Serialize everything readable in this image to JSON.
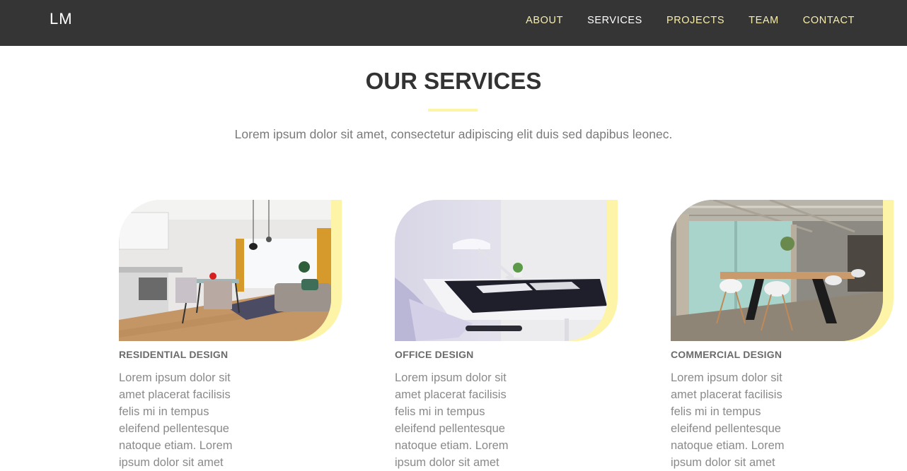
{
  "header": {
    "logo": "LM",
    "nav": [
      {
        "label": "ABOUT"
      },
      {
        "label": "SERVICES"
      },
      {
        "label": "PROJECTS"
      },
      {
        "label": "TEAM"
      },
      {
        "label": "CONTACT"
      }
    ],
    "active_item": "SERVICES"
  },
  "services": {
    "title": "OUR SERVICES",
    "subtitle": "Lorem ipsum dolor sit amet, consectetur adipiscing elit duis sed dapibus leonec.",
    "cards": [
      {
        "title": "RESIDENTIAL DESIGN",
        "text": "Lorem ipsum dolor sit amet placerat facilisis felis mi in tempus eleifend pellentesque natoque etiam. Lorem ipsum dolor sit amet",
        "image": "living-room-photo"
      },
      {
        "title": "OFFICE DESIGN",
        "text": "Lorem ipsum dolor sit amet placerat facilisis felis mi in tempus eleifend pellentesque natoque etiam. Lorem ipsum dolor sit amet",
        "image": "office-desk-photo"
      },
      {
        "title": "COMMERCIAL DESIGN",
        "text": "Lorem ipsum dolor sit amet placerat facilisis felis mi in tempus eleifend pellentesque natoque etiam. Lorem ipsum dolor sit amet",
        "image": "cafe-terrace-photo"
      }
    ]
  },
  "colors": {
    "navbar_bg": "#353535",
    "nav_text": "#f8eeaa",
    "nav_active": "#ffffff",
    "accent": "#fdf4a7",
    "heading": "#333333",
    "body_text": "#8a8a8a"
  }
}
